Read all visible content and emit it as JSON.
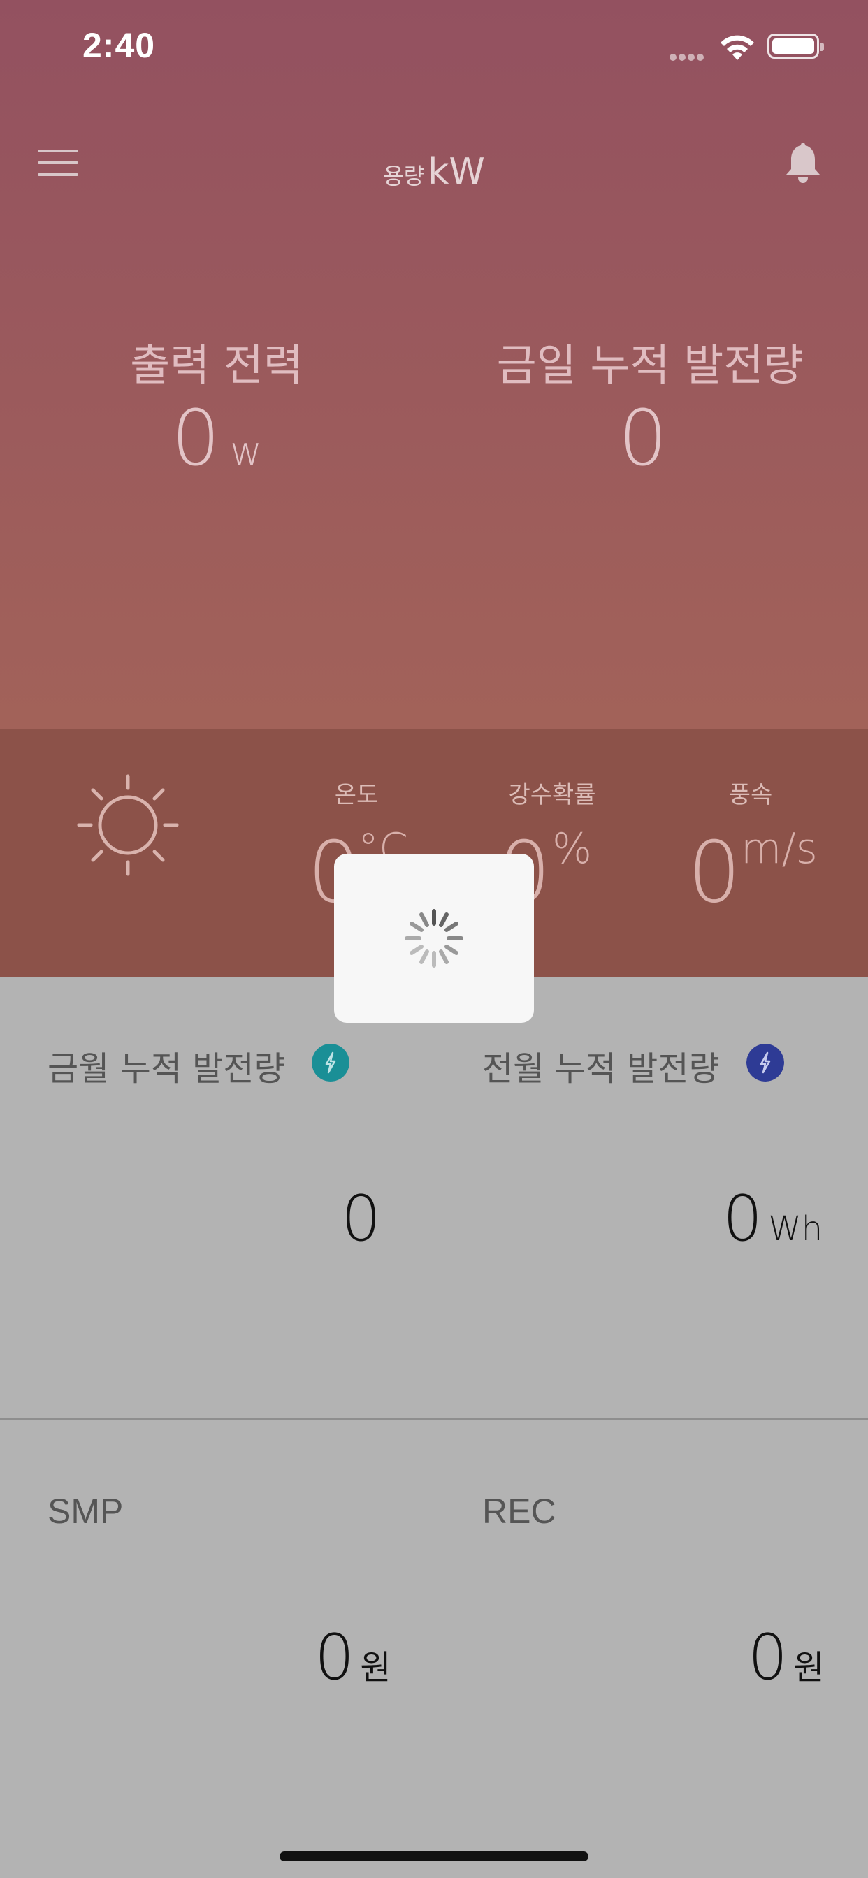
{
  "status": {
    "time": "2:40"
  },
  "header": {
    "capacity_prefix": "용량",
    "capacity_unit": "kW"
  },
  "hero": {
    "output_power_label": "출력 전력",
    "output_power_value": "0",
    "output_power_unit": "w",
    "today_energy_label": "금일 누적 발전량",
    "today_energy_value": "0"
  },
  "weather": {
    "temperature_label": "온도",
    "temperature_value": "0",
    "temperature_unit": "°C",
    "precipitation_label": "강수확률",
    "precipitation_value": "0",
    "precipitation_unit": "%",
    "wind_label": "풍속",
    "wind_value": "0",
    "wind_unit": "m/s"
  },
  "stats": {
    "this_month_label": "금월 누적 발전량",
    "this_month_value": "0",
    "last_month_label": "전월 누적 발전량",
    "last_month_value": "0",
    "last_month_unit": "Wh"
  },
  "prices": {
    "smp_label": "SMP",
    "smp_value": "0",
    "smp_unit": "원",
    "rec_label": "REC",
    "rec_value": "0",
    "rec_unit": "원"
  },
  "colors": {
    "header_gradient_top": "#935160",
    "header_gradient_bottom": "#a26259",
    "weather_band": "#8c5249",
    "this_month_badge": "#1a8f96",
    "last_month_badge": "#2e3b95"
  }
}
